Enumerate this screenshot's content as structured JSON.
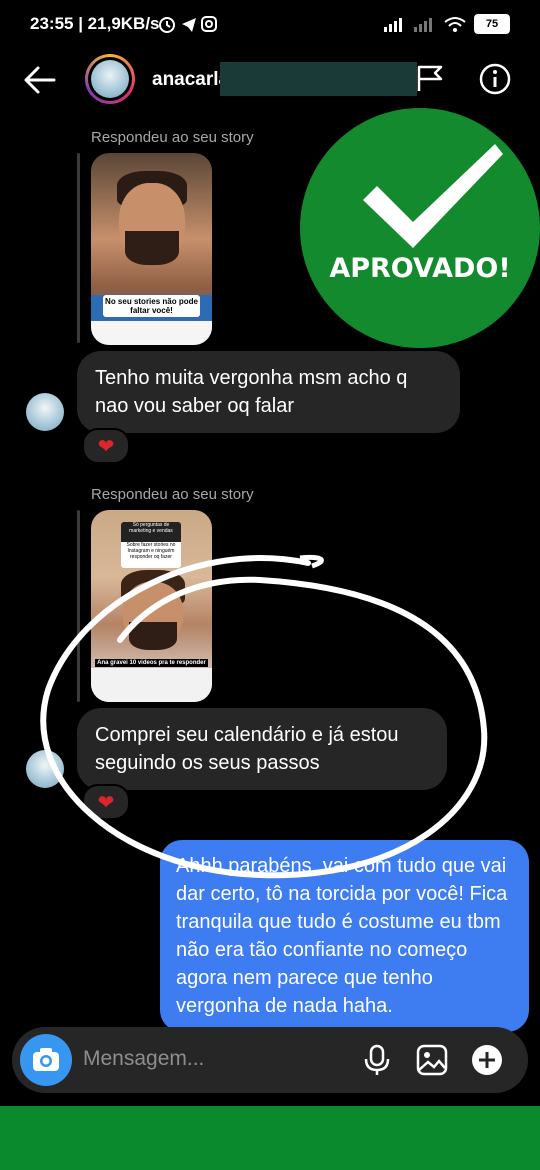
{
  "status_bar": {
    "time_speed": "23:55 | 21,9KB/s",
    "battery": "75"
  },
  "header": {
    "username": "anacarla"
  },
  "conversation": {
    "story_replies": [
      {
        "label": "Respondeu ao seu story",
        "story_caption": "No seu stories não pode faltar você!"
      },
      {
        "label": "Respondeu ao seu story",
        "story_question_title": "Só perguntas de marketing e vendas",
        "story_question_answer": "Sobre fazer stories no Instagram e ninguém responder oq fazer",
        "story_caption": "Ana gravei 10 videos pra te responder"
      }
    ],
    "incoming": [
      {
        "text": "Tenho muita vergonha msm acho q nao vou saber oq falar",
        "reaction": "❤"
      },
      {
        "text": "Comprei seu calendário e já estou seguindo os seus passos",
        "reaction": "❤"
      }
    ],
    "outgoing": [
      {
        "text": "Ahhh parabéns, vai com tudo que vai dar certo, tô na torcida por você! Fica tranquila que tudo é costume eu tbm não era tão confiante no começo agora nem parece que tenho vergonha de nada haha."
      }
    ]
  },
  "badge": {
    "label": "APROVADO!",
    "color": "#138a2d"
  },
  "composer": {
    "placeholder": "Mensagem..."
  },
  "colors": {
    "outgoing_bubble": "#3d7cf1",
    "incoming_bubble": "#262626",
    "accent_bar": "#0a8a2c"
  }
}
